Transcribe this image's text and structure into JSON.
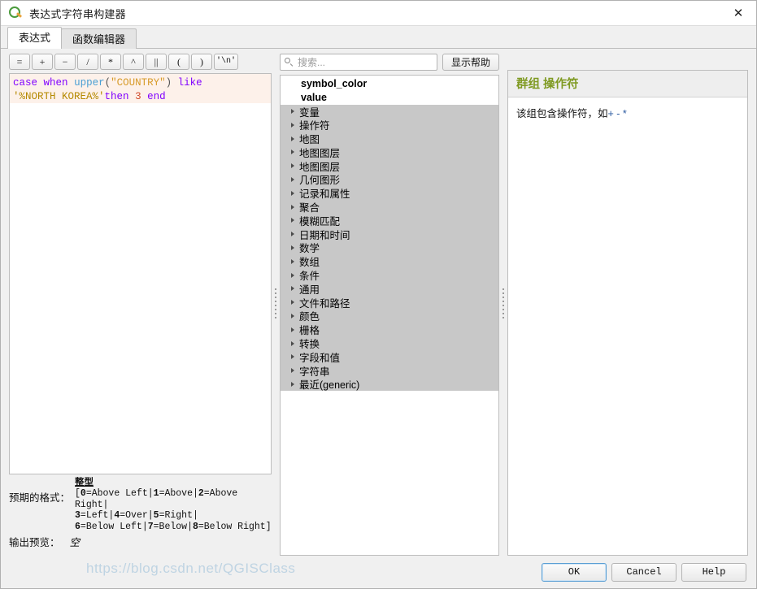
{
  "window": {
    "title": "表达式字符串构建器",
    "app_icon": "qgis-q-icon",
    "close_label": "✕"
  },
  "tabs": [
    {
      "label": "表达式",
      "active": true
    },
    {
      "label": "函数编辑器",
      "active": false
    }
  ],
  "operator_buttons": [
    {
      "label": "=",
      "name": "op-equals"
    },
    {
      "label": "+",
      "name": "op-plus"
    },
    {
      "label": "−",
      "name": "op-minus"
    },
    {
      "label": "/",
      "name": "op-divide"
    },
    {
      "label": "*",
      "name": "op-multiply"
    },
    {
      "label": "^",
      "name": "op-power"
    },
    {
      "label": "||",
      "name": "op-concat"
    },
    {
      "label": "(",
      "name": "op-paren-open"
    },
    {
      "label": ")",
      "name": "op-paren-close"
    },
    {
      "label": "'\\n'",
      "name": "op-newline"
    }
  ],
  "expression": {
    "full_text": "case when upper(\"COUNTRY\") like '%NORTH KOREA%'then 3 end",
    "tokens": [
      {
        "t": "case",
        "cls": "kw"
      },
      {
        "t": " ",
        "cls": "plain"
      },
      {
        "t": "when",
        "cls": "kw"
      },
      {
        "t": " ",
        "cls": "plain"
      },
      {
        "t": "upper",
        "cls": "fn"
      },
      {
        "t": "(",
        "cls": "punct"
      },
      {
        "t": "\"COUNTRY\"",
        "cls": "field"
      },
      {
        "t": ")",
        "cls": "punct"
      },
      {
        "t": " ",
        "cls": "plain"
      },
      {
        "t": "like",
        "cls": "kw"
      },
      {
        "t": "\n",
        "cls": "plain"
      },
      {
        "t": "'%NORTH KOREA%'",
        "cls": "str"
      },
      {
        "t": "then",
        "cls": "kw"
      },
      {
        "t": " ",
        "cls": "plain"
      },
      {
        "t": "3",
        "cls": "num"
      },
      {
        "t": " ",
        "cls": "plain"
      },
      {
        "t": "end",
        "cls": "kw"
      }
    ]
  },
  "preview": {
    "format_label": "预期的格式：",
    "format_type": "整型",
    "format_lines": [
      "[0=Above Left|1=Above|2=Above Right|",
      "3=Left|4=Over|5=Right|",
      "6=Below Left|7=Below|8=Below Right]"
    ],
    "output_label": "输出预览：",
    "output_value": "空"
  },
  "search": {
    "placeholder": "搜索...",
    "value": "",
    "icon": "search-icon"
  },
  "help_toggle": {
    "label": "显示帮助"
  },
  "tree": {
    "fields": [
      {
        "label": "symbol_color"
      },
      {
        "label": "value"
      }
    ],
    "groups": [
      {
        "label": "变量"
      },
      {
        "label": "操作符"
      },
      {
        "label": "地图"
      },
      {
        "label": "地图图层"
      },
      {
        "label": "地图图层"
      },
      {
        "label": "几何图形"
      },
      {
        "label": "记录和属性"
      },
      {
        "label": "聚合"
      },
      {
        "label": "模糊匹配"
      },
      {
        "label": "日期和时间"
      },
      {
        "label": "数学"
      },
      {
        "label": "数组"
      },
      {
        "label": "条件"
      },
      {
        "label": "通用"
      },
      {
        "label": "文件和路径"
      },
      {
        "label": "颜色"
      },
      {
        "label": "栅格"
      },
      {
        "label": "转换"
      },
      {
        "label": "字段和值"
      },
      {
        "label": "字符串"
      },
      {
        "label": "最近(generic)"
      }
    ]
  },
  "help": {
    "title": "群组 操作符",
    "body_prefix": "该组包含操作符，如",
    "body_ops": "+ - *"
  },
  "footer": {
    "ok": "OK",
    "cancel": "Cancel",
    "help": "Help"
  },
  "watermark": {
    "text": "https://blog.csdn.net/QGISClass"
  },
  "colors": {
    "help_title": "#7f9a22",
    "keyword": "#8000ff",
    "function": "#4a9fd4",
    "field": "#d79b2a",
    "string": "#b58900",
    "number": "#d04a2a",
    "expression_bg": "#fdf1ea",
    "group_row_bg": "#c8c8c8",
    "accent": "#5a9fd4"
  }
}
